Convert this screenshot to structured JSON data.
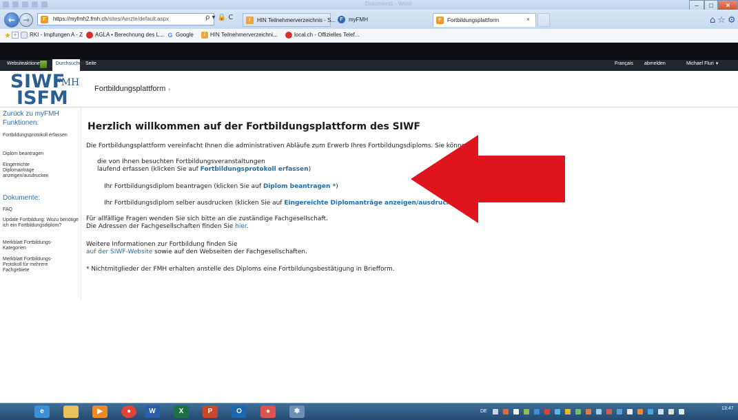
{
  "browser": {
    "address": "https://myfmh2.fmh.ch/sites/Aerzte/default.aspx",
    "address_host": "https://myfmh2.fmh.ch",
    "address_path": "/sites/Aerzte/default.aspx",
    "address_controls": "ρ ▾ 🔒 C",
    "window_title": "Dokument1 - Word",
    "tabs": [
      {
        "label": "HIN Teilnehmerverzeichnis - S...",
        "icon": "hin-icon",
        "color": "#f0a43a"
      },
      {
        "label": "myFMH",
        "icon": "fmh-icon",
        "color": "#2d6db8"
      },
      {
        "label": "Fortbildungsplattform",
        "icon": "fmh-orange-icon",
        "color": "#f29b1e"
      }
    ],
    "close_tab": "×",
    "favorites": [
      {
        "label": "RKI - Impfungen A - Z",
        "icon": "page-icon",
        "color": "#e6ecf4"
      },
      {
        "label": "AGLA • Berechnung des L...",
        "icon": "agla-icon",
        "color": "#d62d20"
      },
      {
        "label": "Google",
        "icon": "google-icon",
        "color": "#4285f4"
      },
      {
        "label": "HIN Teilnehmerverzeichni...",
        "icon": "hin-icon",
        "color": "#f0a43a"
      },
      {
        "label": "local.ch - Offizielles Telef...",
        "icon": "local-icon",
        "color": "#d8332a"
      }
    ]
  },
  "sharepoint": {
    "site_actions": "Websiteaktionen",
    "browse": "Durchsuchen",
    "page": "Seite",
    "language": "Français",
    "logout": "abmelden",
    "user": "Michael Fluri"
  },
  "header": {
    "logo_top": "SIWF",
    "logo_sub": "FMH",
    "logo_bottom": "ISFM",
    "breadcrumb": "Fortbildungsplattform",
    "breadcrumb_arrow": "›"
  },
  "leftnav": {
    "back": "Zurück zu myFMH",
    "functions_title": "Funktionen:",
    "functions": [
      "Fortbildungsprotokoll erfassen",
      "Diplom beantragen",
      "Eingereichte Diplomanträge anzeigen/ausdrucken"
    ],
    "documents_title": "Dokumente:",
    "documents": [
      "FAQ",
      "Update Fortbildung: Wozu benötige ich ein Fortbildungsdiplom?",
      "Merkblatt Fortbildungs-Kategorien",
      "Merkblatt Fortbildungs-Protokoll für mehrere Fachgebiete"
    ]
  },
  "content": {
    "title": "Herzlich willkommen auf der Fortbildungsplattform des SIWF",
    "intro": "Die Fortbildungsplattform vereinfacht Ihnen die administrativen Abläufe zum Erwerb Ihres Fortbildungsdiploms. Sie können:",
    "item1_line1": "die von Ihnen besuchten Fortbildungsveranstaltungen",
    "item1_line2_pre": "laufend erfassen (klicken Sie auf ",
    "item1_link": "Fortbildungsprotokoll erfassen",
    "item1_post": ")",
    "item2_pre": "Ihr Fortbildungsdiplom beantragen (klicken Sie auf ",
    "item2_link": "Diplom beantragen *",
    "item2_post": ")",
    "item3_pre": "Ihr Fortbildungsdiplom selber ausdrucken (klicken Sie auf ",
    "item3_link": "Eingereichte Diplomanträge anzeigen/ausdrucken",
    "item3_post": ")",
    "questions_line1": "Für allfällige Fragen wenden Sie sich bitte an die zuständige Fachgesellschaft.",
    "questions_line2_pre": "Die Adressen der Fachgesellschaften finden Sie ",
    "questions_link": "hier",
    "questions_post": ".",
    "more_line1": "Weitere Informationen zur Fortbildung finden Sie",
    "more_link": "auf der SIWF-Website",
    "more_post": " sowie auf den Webseiten der Fachgesellschaften.",
    "footnote": "* Nichtmitglieder der FMH erhalten anstelle des Diploms eine Fortbildungsbestätigung in Briefform."
  },
  "taskbar": {
    "apps": [
      {
        "icon": "ie-icon",
        "color": "#3b8fd8",
        "label": "e"
      },
      {
        "icon": "explorer-icon",
        "color": "#e8c15a",
        "label": ""
      },
      {
        "icon": "media-icon",
        "color": "#f08a24",
        "label": "▶"
      },
      {
        "icon": "chrome-icon",
        "color": "#e24335",
        "label": "●"
      },
      {
        "icon": "word-icon",
        "color": "#2b5fad",
        "label": "W"
      },
      {
        "icon": "excel-icon",
        "color": "#1e7145",
        "label": "X"
      },
      {
        "icon": "powerpoint-icon",
        "color": "#c9462b",
        "label": "P"
      },
      {
        "icon": "outlook-icon",
        "color": "#1c67b0",
        "label": "O"
      },
      {
        "icon": "app-icon",
        "color": "#d9534f",
        "label": "●"
      },
      {
        "icon": "bug-icon",
        "color": "#6b8fb5",
        "label": "✱"
      }
    ],
    "language": "DE",
    "time": "13:47"
  },
  "colors": {
    "accent_blue": "#2b5f93",
    "link_blue": "#1f6cab",
    "arrow_red": "#e0141c",
    "ribbon_dark": "#21272d"
  }
}
